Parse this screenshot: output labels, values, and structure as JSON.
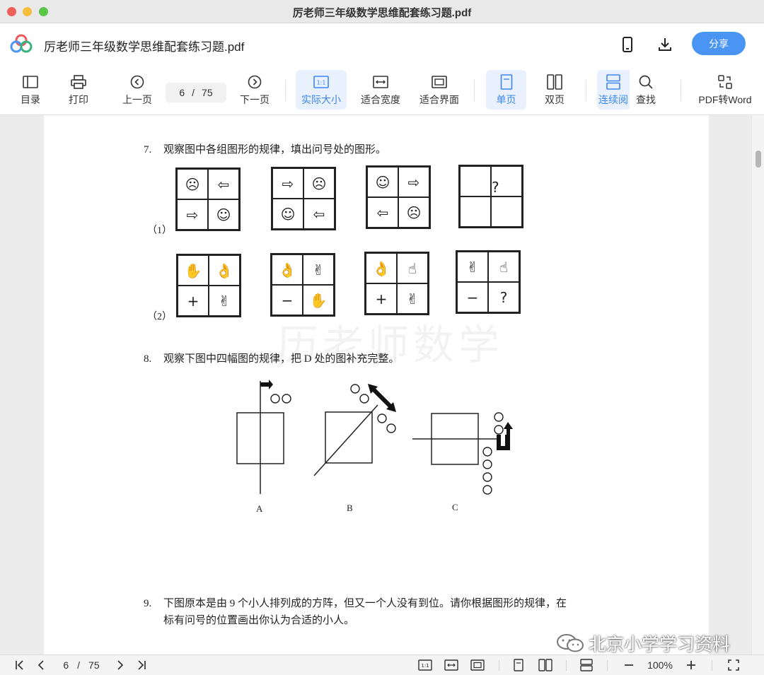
{
  "window": {
    "title": "厉老师三年级数学思维配套练习题.pdf"
  },
  "header": {
    "doc_title": "厉老师三年级数学思维配套练习题.pdf",
    "share_label": "分享"
  },
  "toolbar": {
    "toc": "目录",
    "print": "打印",
    "prev_page": "上一页",
    "current_page": "6",
    "page_separator": "/",
    "total_pages": "75",
    "next_page": "下一页",
    "actual_size": "实际大小",
    "fit_width": "适合宽度",
    "fit_window": "适合界面",
    "single_page": "单页",
    "double_page": "双页",
    "continuous": "连续阅",
    "find": "查找",
    "pdf_to_word": "PDF转Word"
  },
  "document": {
    "q7": {
      "num": "7.",
      "text": "观察图中各组图形的规律，填出问号处的图形。"
    },
    "q7_row1_label": "（1）",
    "q7_row2_label": "（2）",
    "row1": [
      [
        "☹",
        "⇦",
        "⇨",
        "☺"
      ],
      [
        "⇨",
        "☹",
        "☺",
        "⇦"
      ],
      [
        "☺",
        "⇨",
        "⇦",
        "☹"
      ],
      [
        "",
        "?",
        "",
        ""
      ]
    ],
    "row2": [
      [
        "✋",
        "👌",
        "+",
        "✌"
      ],
      [
        "👌",
        "✌",
        "−",
        "✋"
      ],
      [
        "👌",
        "☝",
        "+",
        "✌"
      ],
      [
        "✌",
        "☝",
        "−",
        "?"
      ]
    ],
    "watermark": "历老师数学",
    "q8": {
      "num": "8.",
      "text": "观察下图中四幅图的规律，把 D 处的图补充完整。"
    },
    "fig_a": "A",
    "fig_b": "B",
    "fig_c": "C",
    "q9": {
      "num": "9.",
      "line1": "下图原本是由 9 个小人排列成的方阵，但又一个人没有到位。请你根据图形的规律，在",
      "line2": "标有问号的位置画出你认为合适的小人。"
    }
  },
  "statusbar": {
    "current_page": "6",
    "page_separator": "/",
    "total_pages": "75",
    "zoom": "100%"
  },
  "overlay": {
    "wechat_label": "北京小学学习资料"
  }
}
